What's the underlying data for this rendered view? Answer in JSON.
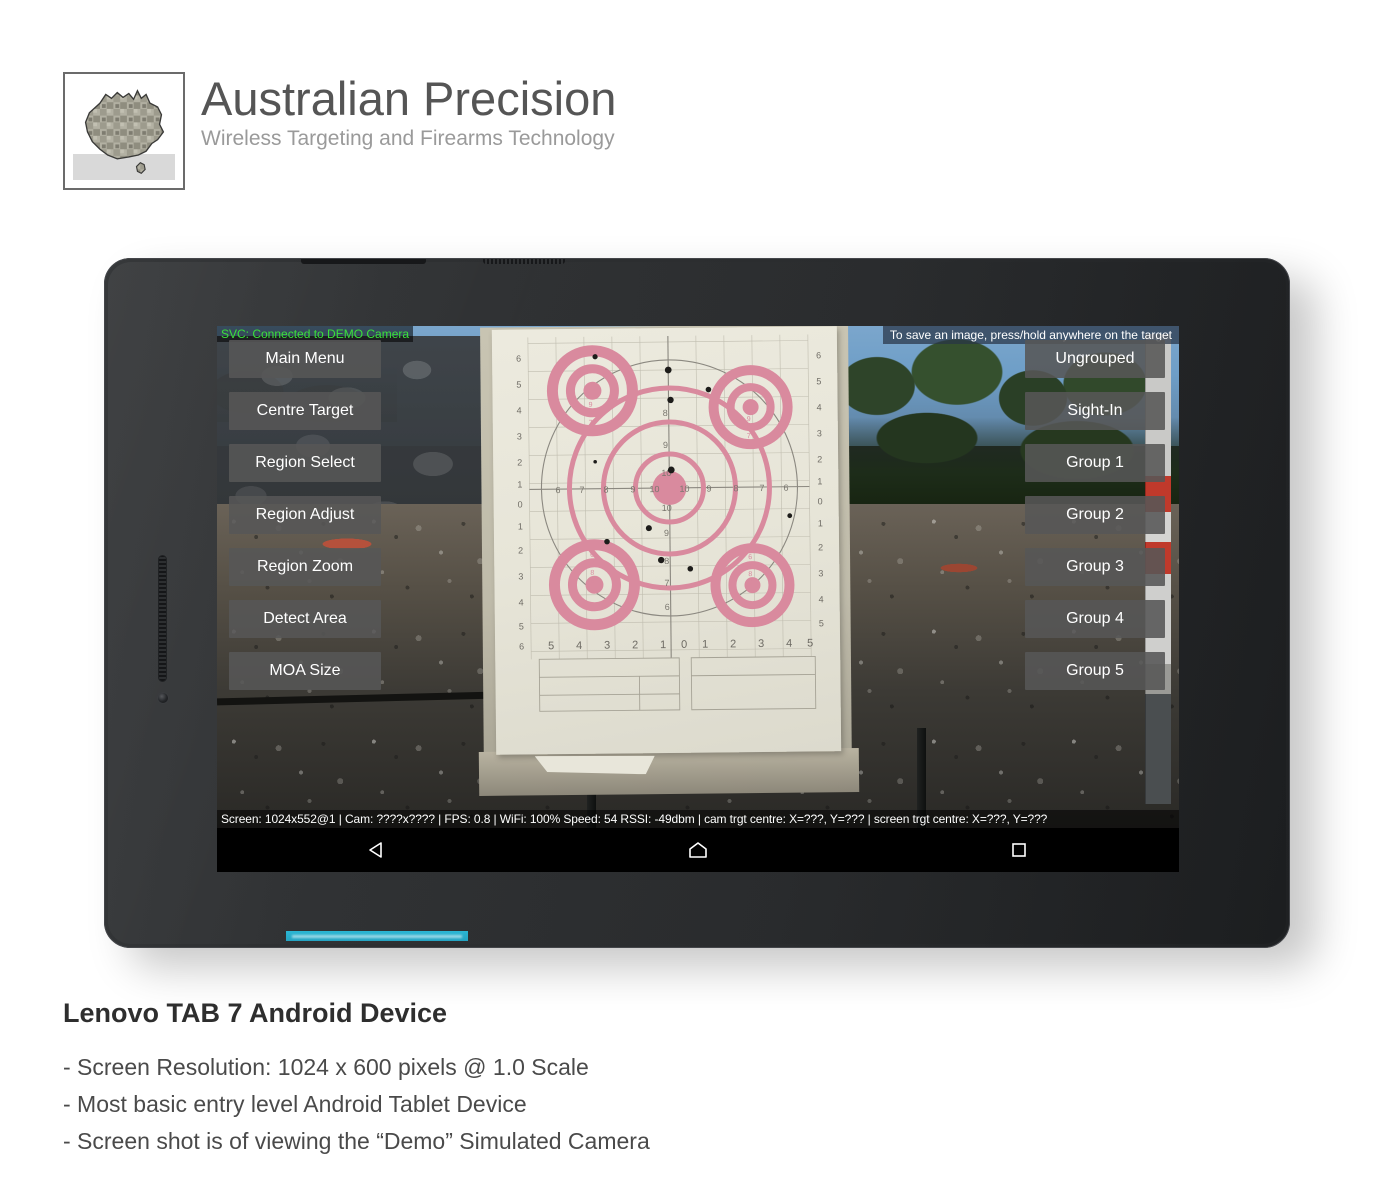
{
  "brand": {
    "title": "Australian Precision",
    "subtitle": "Wireless Targeting and Firearms Technology",
    "logo_icon": "australia-map-camo-icon"
  },
  "device": {
    "screen": {
      "svc_status": "SVC: Connected to DEMO Camera",
      "save_hint": "To save an image, press/hold anywhere on the target",
      "status_bar": "Screen: 1024x552@1 | Cam: ????x???? | FPS: 0.8 | WiFi: 100% Speed: 54 RSSI: -49dbm | cam trgt centre: X=???, Y=??? | screen trgt centre: X=???, Y=???",
      "status_fields": {
        "screen": "1024x552@1",
        "cam": "????x????",
        "fps": "0.8",
        "wifi": "100%",
        "speed": "54",
        "rssi": "-49dbm",
        "cam_trgt_centre_x": "???",
        "cam_trgt_centre_y": "???",
        "screen_trgt_centre_x": "???",
        "screen_trgt_centre_y": "???"
      },
      "left_buttons": [
        {
          "label": "Main Menu",
          "name": "main-menu-button"
        },
        {
          "label": "Centre Target",
          "name": "centre-target-button"
        },
        {
          "label": "Region Select",
          "name": "region-select-button"
        },
        {
          "label": "Region Adjust",
          "name": "region-adjust-button"
        },
        {
          "label": "Region Zoom",
          "name": "region-zoom-button"
        },
        {
          "label": "Detect Area",
          "name": "detect-area-button"
        },
        {
          "label": "MOA Size",
          "name": "moa-size-button"
        }
      ],
      "right_buttons": [
        {
          "label": "Ungrouped",
          "name": "ungrouped-button"
        },
        {
          "label": "Sight-In",
          "name": "sight-in-button"
        },
        {
          "label": "Group 1",
          "name": "group-1-button"
        },
        {
          "label": "Group 2",
          "name": "group-2-button"
        },
        {
          "label": "Group 3",
          "name": "group-3-button"
        },
        {
          "label": "Group 4",
          "name": "group-4-button"
        },
        {
          "label": "Group 5",
          "name": "group-5-button"
        }
      ],
      "nav_bar": [
        {
          "name": "back-icon"
        },
        {
          "name": "home-icon"
        },
        {
          "name": "recents-icon"
        }
      ]
    },
    "target": {
      "ring_labels_centre": [
        "10",
        "10",
        "10",
        "10",
        "9",
        "9",
        "8",
        "8",
        "7",
        "6"
      ],
      "scale_bottom": [
        "5",
        "4",
        "3",
        "2",
        "1",
        "0",
        "1",
        "2",
        "3",
        "4",
        "5"
      ],
      "scale_left": [
        "6",
        "5",
        "4",
        "3",
        "2",
        "1",
        "0",
        "1",
        "2",
        "3",
        "4",
        "5",
        "6"
      ],
      "corner_ring_labels": [
        "9",
        "8",
        "7",
        "6"
      ],
      "ring_color": "#d98a9e",
      "paper_color": "#eceade"
    }
  },
  "caption": {
    "title": "Lenovo TAB 7 Android Device",
    "lines": [
      "- Screen Resolution: 1024 x 600 pixels @ 1.0 Scale",
      "- Most basic entry level Android Tablet Device",
      "- Screen shot is of viewing the “Demo” Simulated Camera"
    ]
  }
}
